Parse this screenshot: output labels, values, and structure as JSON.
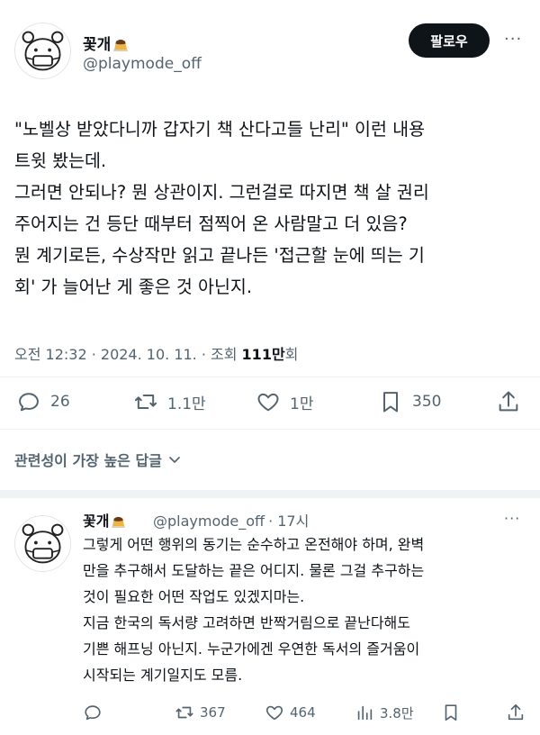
{
  "main_post": {
    "display_name": "꽃개",
    "handle": "@playmode_off",
    "follow_label": "팔로우",
    "text_lines": [
      "\"노벨상 받았다니까 갑자기 책 산다고들 난리\" 이런 내용",
      "트윗 봤는데.",
      "그러면 안되나? 뭔 상관이지. 그런걸로 따지면 책 살 권리",
      "주어지는 건 등단 때부터 점찍어 온 사람말고 더 있음?",
      "뭔 계기로든, 수상작만 읽고 끝나든 '접근할 눈에 띄는 기",
      "회' 가 늘어난 게 좋은 것 아닌지."
    ],
    "meta": {
      "time_date": "오전 12:32 · 2024. 10. 11. · 조회 ",
      "views": "111만",
      "views_suffix": "회"
    },
    "actions": {
      "replies": "26",
      "reposts": "1.1만",
      "likes": "1만",
      "bookmarks": "350"
    }
  },
  "relevant_replies_label": "관련성이 가장 높은 답글",
  "reply": {
    "display_name": "꽃개",
    "handle": "@playmode_off",
    "time": "· 17시",
    "text_lines": [
      "그렇게 어떤 행위의 동기는 순수하고 온전해야 하며, 완벽",
      "만을 추구해서 도달하는 끝은 어디지. 물론 그걸 추구하는",
      "것이 필요한 어떤 작업도 있겠지마는.",
      "지금 한국의 독서량 고려하면 반짝거림으로 끝난다해도",
      "기쁜 해프닝 아닌지. 누군가에겐 우연한 독서의 즐거움이",
      "시작되는 계기일지도 모름."
    ],
    "actions": {
      "replies": "",
      "reposts": "367",
      "likes": "464",
      "views": "3.8만"
    }
  },
  "icons": [
    "avatar-mascot",
    "pudding-emoji",
    "more-dots-icon",
    "reply-icon",
    "repost-icon",
    "like-icon",
    "bookmark-icon",
    "share-icon",
    "chevron-down-icon",
    "views-icon"
  ],
  "colors": {
    "text": "#0f1419",
    "secondary": "#536471",
    "divider": "#eff3f4",
    "button": "#0f1419"
  }
}
